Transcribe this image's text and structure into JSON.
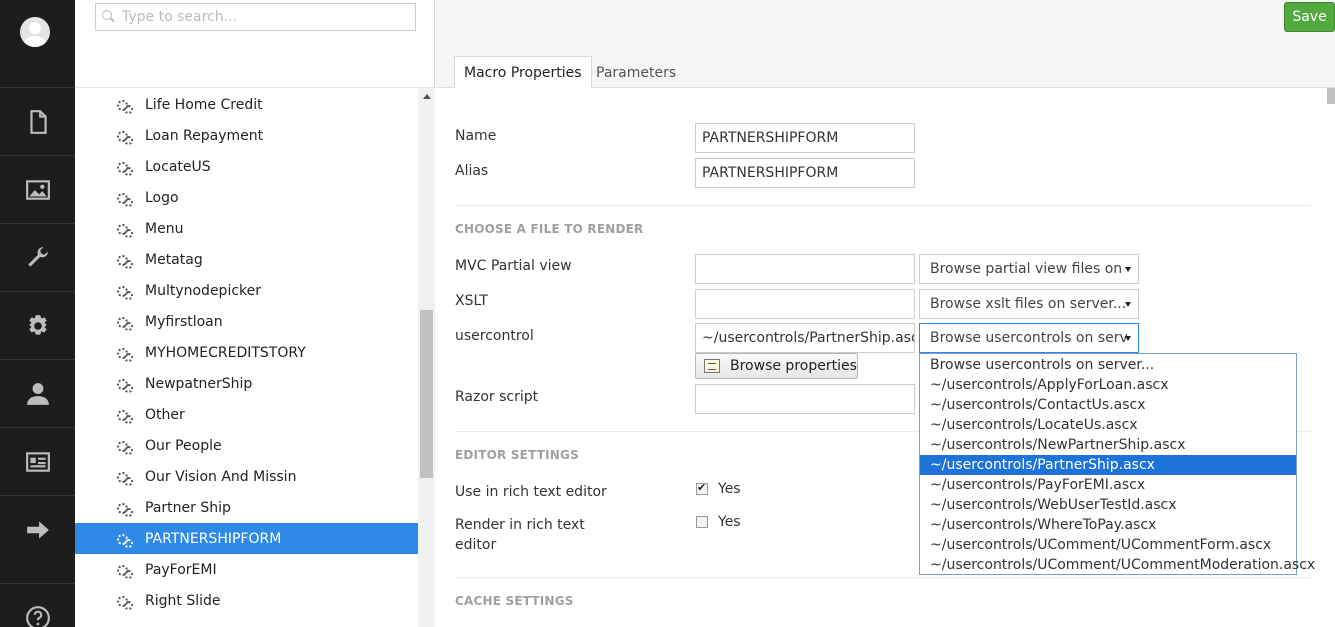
{
  "rail": {
    "items": [
      {
        "icon": "document-icon"
      },
      {
        "icon": "media-icon"
      },
      {
        "icon": "wrench-icon"
      },
      {
        "icon": "gear-icon"
      },
      {
        "icon": "user-icon"
      },
      {
        "icon": "id-card-icon"
      },
      {
        "icon": "arrow-right-icon"
      },
      {
        "icon": "help-icon"
      }
    ]
  },
  "search": {
    "placeholder": "Type to search..."
  },
  "tree": {
    "items": [
      "Life Home Credit",
      "Loan Repayment",
      "LocateUS",
      "Logo",
      "Menu",
      "Metatag",
      "Multynodepicker",
      "Myfirstloan",
      "MYHOMECREDITSTORY",
      "NewpatnerShip",
      "Other",
      "Our People",
      "Our Vision And Missin",
      "Partner Ship",
      "PARTNERSHIPFORM",
      "PayForEMI",
      "Right Slide"
    ],
    "active": "PARTNERSHIPFORM"
  },
  "header": {
    "save_label": "Save",
    "tabs": [
      "Macro Properties",
      "Parameters"
    ],
    "active_tab": "Macro Properties"
  },
  "form": {
    "name_label": "Name",
    "name_value": "PARTNERSHIPFORM",
    "alias_label": "Alias",
    "alias_value": "PARTNERSHIPFORM",
    "file_section": "CHOOSE A FILE TO RENDER",
    "mvc_label": "MVC Partial view",
    "mvc_value": "",
    "mvc_select": "Browse partial view files on",
    "xslt_label": "XSLT",
    "xslt_value": "",
    "xslt_select": "Browse xslt files on server...",
    "usercontrol_label": "usercontrol",
    "usercontrol_value": "~/usercontrols/PartnerShip.ascx",
    "usercontrol_select": "Browse usercontrols on serv",
    "browse_properties": "Browse properties",
    "razor_label": "Razor script",
    "razor_value": "",
    "editor_section": "EDITOR SETTINGS",
    "use_rte_label": "Use in rich text editor",
    "use_rte_yes": "Yes",
    "use_rte_checked": true,
    "render_rte_label_1": "Render in rich text",
    "render_rte_label_2": "editor",
    "render_rte_yes": "Yes",
    "render_rte_checked": false,
    "cache_section": "CACHE SETTINGS"
  },
  "dropdown": {
    "options": [
      "Browse usercontrols on server...",
      "~/usercontrols/ApplyForLoan.ascx",
      "~/usercontrols/ContactUs.ascx",
      "~/usercontrols/LocateUs.ascx",
      "~/usercontrols/NewPartnerShip.ascx",
      "~/usercontrols/PartnerShip.ascx",
      "~/usercontrols/PayForEMI.ascx",
      "~/usercontrols/WebUserTestId.ascx",
      "~/usercontrols/WhereToPay.ascx",
      "~/usercontrols/UComment/UCommentForm.ascx",
      "~/usercontrols/UComment/UCommentModeration.ascx"
    ],
    "selected": "~/usercontrols/PartnerShip.ascx"
  },
  "colors": {
    "rail_bg": "#1d1d1d",
    "active_tree": "#2e8ae6",
    "save_green": "#53a93f",
    "dropdown_selected": "#1e73d8"
  }
}
